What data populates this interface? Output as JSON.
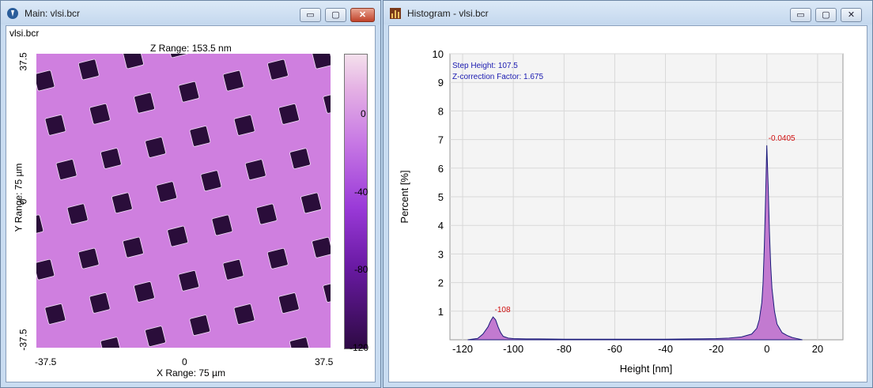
{
  "main_window": {
    "title": "Main: vlsi.bcr",
    "file_label": "vlsi.bcr",
    "z_range_label": "Z Range:  153.5 nm",
    "x_range_label": "X Range: 75 µm",
    "y_range_label": "Y Range: 75 µm",
    "x_ticks": [
      "-37.5",
      "0",
      "37.5"
    ],
    "y_ticks": [
      "37.5",
      "0",
      "-37.5"
    ],
    "colorbar_ticks": [
      "0",
      "-40",
      "-80",
      "-120"
    ],
    "colors": {
      "surface": "#cf7fdf",
      "pit": "#2a0d3a"
    }
  },
  "histogram_window": {
    "title": "Histogram - vlsi.bcr",
    "step_height_label": "Step Height:  107.5",
    "z_correction_label": "Z-correction Factor:  1.675",
    "xlabel": "Height [nm]",
    "ylabel": "Percent [%]",
    "peak_labels": [
      "-108",
      "-0.0405"
    ]
  },
  "window_buttons": {
    "minimize": "▭",
    "maximize": "▢",
    "close": "✕"
  },
  "chart_data": {
    "type": "area",
    "xlim": [
      -125,
      30
    ],
    "ylim": [
      0,
      10
    ],
    "x_ticks": [
      -120,
      -100,
      -80,
      -60,
      -40,
      -20,
      0,
      20
    ],
    "y_ticks": [
      1,
      2,
      3,
      4,
      5,
      6,
      7,
      8,
      9,
      10
    ],
    "grid": true,
    "x": [
      -118,
      -114,
      -112,
      -110,
      -109,
      -108,
      -107,
      -106,
      -105,
      -104,
      -102,
      -100,
      -95,
      -90,
      -80,
      -70,
      -60,
      -50,
      -40,
      -30,
      -20,
      -15,
      -10,
      -6,
      -4,
      -3,
      -2,
      -1.5,
      -1,
      -0.5,
      -0.0405,
      0.5,
      1,
      1.5,
      2,
      3,
      4,
      6,
      8,
      10,
      12,
      14
    ],
    "values": [
      0,
      0.05,
      0.2,
      0.45,
      0.65,
      0.8,
      0.7,
      0.45,
      0.25,
      0.12,
      0.06,
      0.04,
      0.03,
      0.03,
      0.02,
      0.02,
      0.02,
      0.02,
      0.02,
      0.03,
      0.04,
      0.06,
      0.1,
      0.2,
      0.4,
      0.7,
      1.3,
      2.0,
      3.3,
      5.0,
      6.8,
      5.4,
      3.8,
      2.6,
      1.8,
      1.0,
      0.55,
      0.25,
      0.15,
      0.08,
      0.04,
      0.0
    ],
    "annotations": [
      {
        "x": -108,
        "y": 0.8,
        "text": "-108"
      },
      {
        "x": -0.0405,
        "y": 6.8,
        "text": "-0.0405"
      }
    ],
    "xlabel": "Height [nm]",
    "ylabel": "Percent [%]"
  }
}
